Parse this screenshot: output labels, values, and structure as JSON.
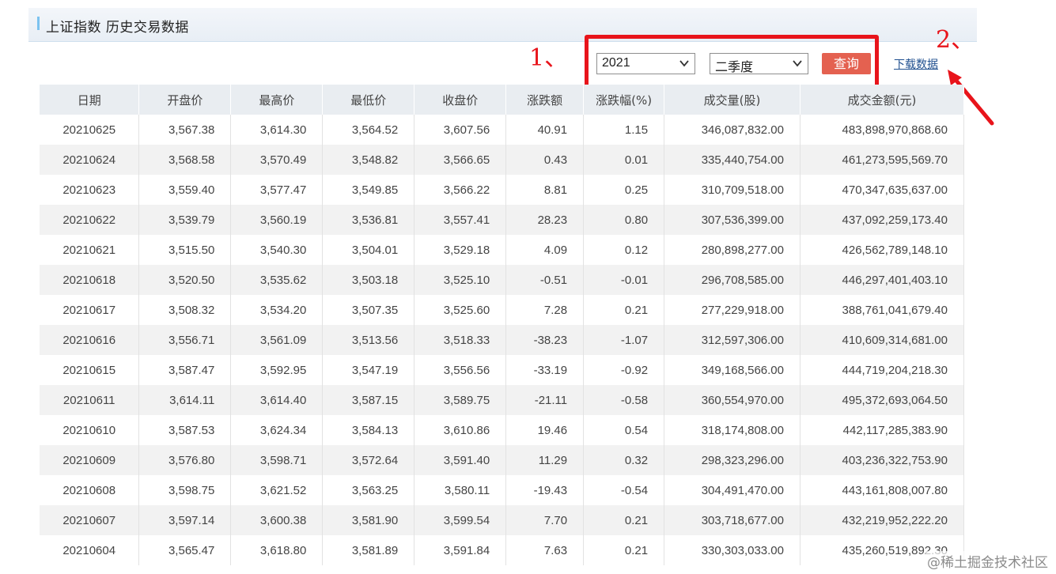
{
  "header": {
    "title": "上证指数  历史交易数据"
  },
  "filters": {
    "year": "2021",
    "quarter": "二季度",
    "query_label": "查询",
    "download_label": "下载数据"
  },
  "annotations": {
    "step1": "1、",
    "step2": "2、"
  },
  "table": {
    "columns": [
      "日期",
      "开盘价",
      "最高价",
      "最低价",
      "收盘价",
      "涨跌额",
      "涨跌幅(%)",
      "成交量(股)",
      "成交金额(元)"
    ],
    "rows": [
      [
        "20210625",
        "3,567.38",
        "3,614.30",
        "3,564.52",
        "3,607.56",
        "40.91",
        "1.15",
        "346,087,832.00",
        "483,898,970,868.60"
      ],
      [
        "20210624",
        "3,568.58",
        "3,570.49",
        "3,548.82",
        "3,566.65",
        "0.43",
        "0.01",
        "335,440,754.00",
        "461,273,595,569.70"
      ],
      [
        "20210623",
        "3,559.40",
        "3,577.47",
        "3,549.85",
        "3,566.22",
        "8.81",
        "0.25",
        "310,709,518.00",
        "470,347,635,637.00"
      ],
      [
        "20210622",
        "3,539.79",
        "3,560.19",
        "3,536.81",
        "3,557.41",
        "28.23",
        "0.80",
        "307,536,399.00",
        "437,092,259,173.40"
      ],
      [
        "20210621",
        "3,515.50",
        "3,540.30",
        "3,504.01",
        "3,529.18",
        "4.09",
        "0.12",
        "280,898,277.00",
        "426,562,789,148.10"
      ],
      [
        "20210618",
        "3,520.50",
        "3,535.62",
        "3,503.18",
        "3,525.10",
        "-0.51",
        "-0.01",
        "296,708,585.00",
        "446,297,401,403.10"
      ],
      [
        "20210617",
        "3,508.32",
        "3,534.20",
        "3,507.35",
        "3,525.60",
        "7.28",
        "0.21",
        "277,229,918.00",
        "388,761,041,679.40"
      ],
      [
        "20210616",
        "3,556.71",
        "3,561.09",
        "3,513.56",
        "3,518.33",
        "-38.23",
        "-1.07",
        "312,597,306.00",
        "410,609,314,681.00"
      ],
      [
        "20210615",
        "3,587.47",
        "3,592.95",
        "3,547.19",
        "3,556.56",
        "-33.19",
        "-0.92",
        "349,168,566.00",
        "444,719,204,218.30"
      ],
      [
        "20210611",
        "3,614.11",
        "3,614.40",
        "3,587.15",
        "3,589.75",
        "-21.11",
        "-0.58",
        "360,554,970.00",
        "495,372,693,064.50"
      ],
      [
        "20210610",
        "3,587.53",
        "3,624.34",
        "3,584.13",
        "3,610.86",
        "19.46",
        "0.54",
        "318,174,808.00",
        "442,117,285,383.90"
      ],
      [
        "20210609",
        "3,576.80",
        "3,598.71",
        "3,572.64",
        "3,591.40",
        "11.29",
        "0.32",
        "298,323,296.00",
        "403,236,322,753.90"
      ],
      [
        "20210608",
        "3,598.75",
        "3,621.52",
        "3,563.25",
        "3,580.11",
        "-19.43",
        "-0.54",
        "304,491,470.00",
        "443,161,808,007.80"
      ],
      [
        "20210607",
        "3,597.14",
        "3,600.38",
        "3,581.90",
        "3,599.54",
        "7.70",
        "0.21",
        "303,718,677.00",
        "432,219,952,222.20"
      ],
      [
        "20210604",
        "3,565.47",
        "3,618.80",
        "3,581.89",
        "3,591.84",
        "7.63",
        "0.21",
        "330,303,033.00",
        "435,260,519,892.30"
      ]
    ]
  },
  "watermark": "@稀土掘金技术社区"
}
